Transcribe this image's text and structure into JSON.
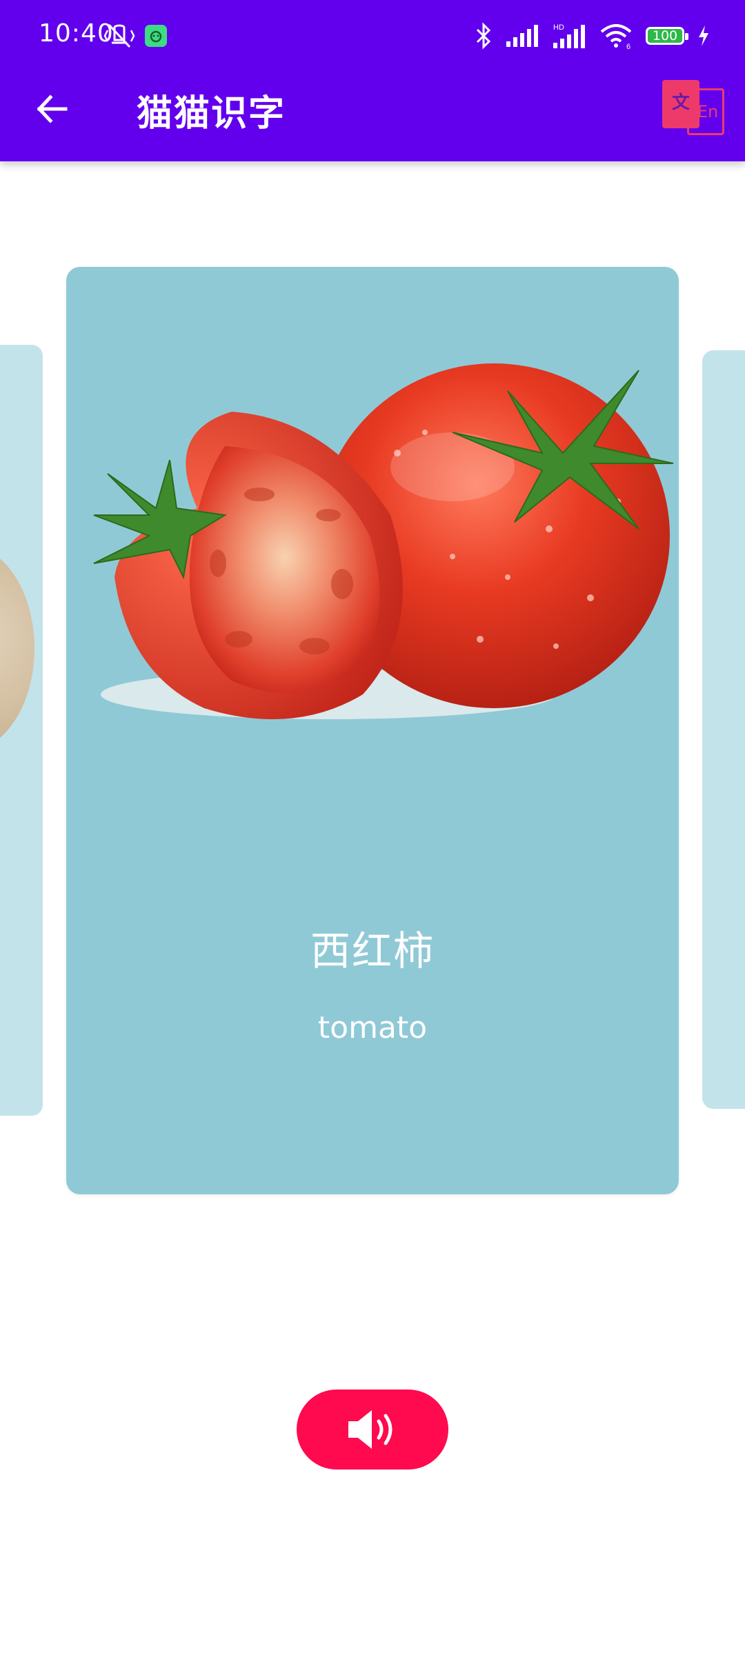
{
  "status_bar": {
    "time": "10:40",
    "battery": "100",
    "network_hd": "HD",
    "wifi_tag": "6"
  },
  "app_bar": {
    "title": "猫猫识字",
    "translate_zh_glyph": "文",
    "translate_en_glyph": "En",
    "background_color": "#6200EE"
  },
  "card": {
    "chinese_word": "西红柿",
    "english_word": "tomato",
    "background_color": "#90C9D6",
    "image_icon": "tomato-image"
  },
  "speaker_button": {
    "icon": "speaker-icon",
    "color": "#FF0A4E"
  }
}
